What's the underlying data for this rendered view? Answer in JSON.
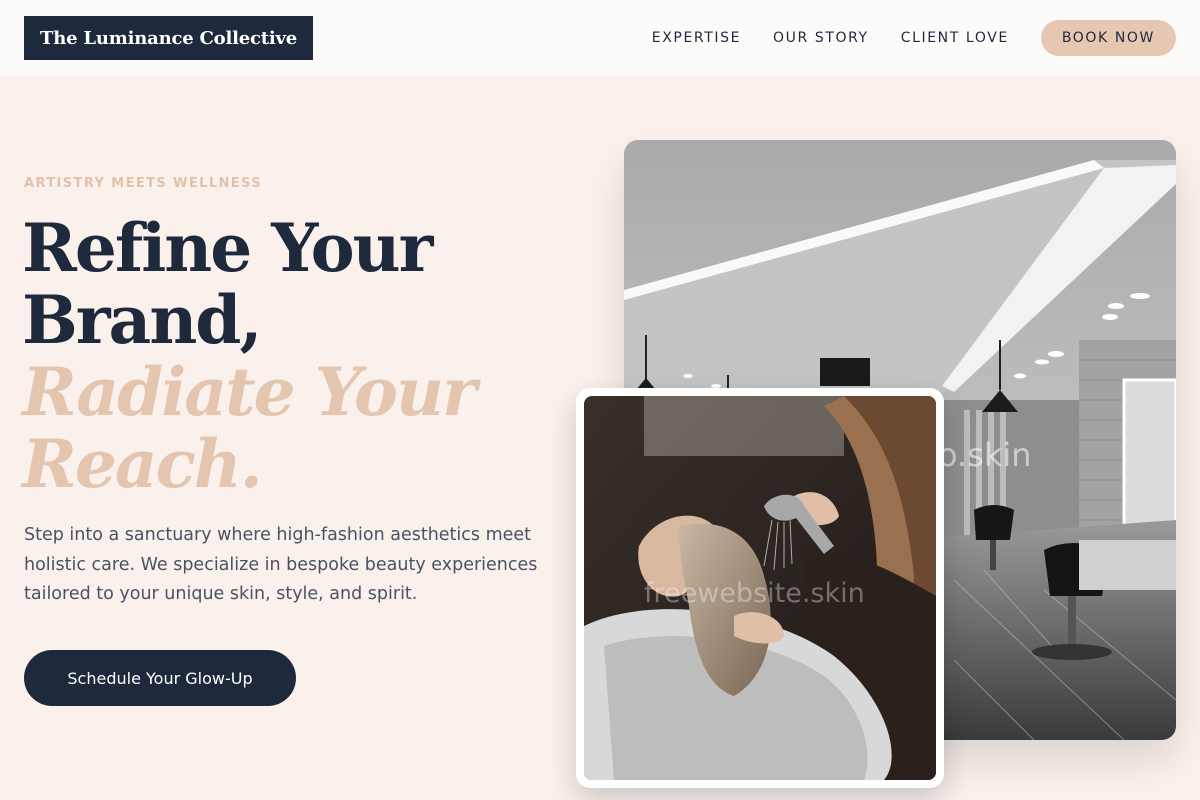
{
  "header": {
    "logo_text": "The Luminance Collective",
    "nav": [
      {
        "label": "EXPERTISE"
      },
      {
        "label": "OUR STORY"
      },
      {
        "label": "CLIENT LOVE"
      }
    ],
    "book_label": "BOOK NOW"
  },
  "hero": {
    "eyebrow": "ARTISTRY MEETS WELLNESS",
    "headline_line1": "Refine Your",
    "headline_line2": "Brand,",
    "headline_accent1": "Radiate Your",
    "headline_accent2": "Reach.",
    "description": "Step into a sanctuary where high-fashion aesthetics meet holistic care. We specialize in bespoke beauty experiences tailored to your unique skin, style, and spirit.",
    "cta_label": "Schedule Your Glow-Up"
  },
  "images": {
    "salon_watermark": "o.skin",
    "wash_watermark": "freewebsite.skin"
  },
  "colors": {
    "background": "#faf1ec",
    "navy": "#1e293b",
    "accent": "#e4c6b0",
    "header_bg": "#fdfbfa"
  }
}
